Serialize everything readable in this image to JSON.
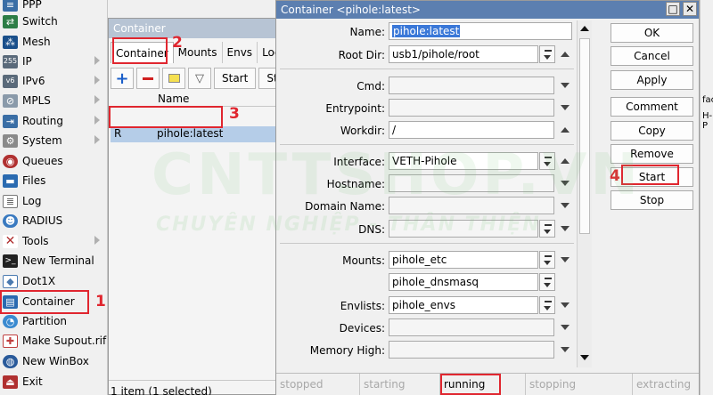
{
  "sidebar": {
    "items": [
      {
        "label": "PPP",
        "icon": "ppp-icon",
        "color": "#3a6ea5",
        "arrow": false
      },
      {
        "label": "Switch",
        "icon": "switch-icon",
        "color": "#2d7d46",
        "arrow": false
      },
      {
        "label": "Mesh",
        "icon": "mesh-icon",
        "color": "#1a4f8a",
        "arrow": false
      },
      {
        "label": "IP",
        "icon": "ip-icon",
        "color": "#5a6a7a",
        "arrow": true
      },
      {
        "label": "IPv6",
        "icon": "ipv6-icon",
        "color": "#5a6a7a",
        "arrow": true
      },
      {
        "label": "MPLS",
        "icon": "mpls-icon",
        "color": "#7a8a9a",
        "arrow": true
      },
      {
        "label": "Routing",
        "icon": "routing-icon",
        "color": "#3a6ea5",
        "arrow": true
      },
      {
        "label": "System",
        "icon": "gear-icon",
        "color": "#7a7a7a",
        "arrow": true
      },
      {
        "label": "Queues",
        "icon": "queues-icon",
        "color": "#b03030",
        "arrow": false
      },
      {
        "label": "Files",
        "icon": "folder-icon",
        "color": "#2a6ab0",
        "arrow": false
      },
      {
        "label": "Log",
        "icon": "log-icon",
        "color": "#6a6a6a",
        "arrow": false
      },
      {
        "label": "RADIUS",
        "icon": "radius-icon",
        "color": "#3a7ac0",
        "arrow": false
      },
      {
        "label": "Tools",
        "icon": "tools-icon",
        "color": "#b03030",
        "arrow": true
      },
      {
        "label": "New Terminal",
        "icon": "terminal-icon",
        "color": "#222222",
        "arrow": false
      },
      {
        "label": "Dot1X",
        "icon": "dot1x-icon",
        "color": "#4a7ab0",
        "arrow": false
      },
      {
        "label": "Container",
        "icon": "container-icon",
        "color": "#2a6ab0",
        "arrow": false
      },
      {
        "label": "Partition",
        "icon": "partition-icon",
        "color": "#3a8ad0",
        "arrow": false
      },
      {
        "label": "Make Supout.rif",
        "icon": "supout-icon",
        "color": "#c04040",
        "arrow": false
      },
      {
        "label": "New WinBox",
        "icon": "winbox-icon",
        "color": "#2a5a9a",
        "arrow": false
      },
      {
        "label": "Exit",
        "icon": "exit-icon",
        "color": "#b03030",
        "arrow": false
      }
    ]
  },
  "list_window": {
    "title": "Container",
    "tabs": [
      "Container",
      "Mounts",
      "Envs",
      "Log"
    ],
    "toolbar": {
      "start": "Start",
      "stop_truncated": "Sto"
    },
    "header": {
      "name": "Name"
    },
    "row": {
      "flag": "R",
      "name": "pihole:latest"
    },
    "status": "1 item (1 selected)"
  },
  "dialog": {
    "title": "Container <pihole:latest>",
    "fields": {
      "name": {
        "label": "Name:",
        "value": "pihole:latest"
      },
      "root_dir": {
        "label": "Root Dir:",
        "value": "usb1/pihole/root"
      },
      "cmd": {
        "label": "Cmd:",
        "value": ""
      },
      "entrypoint": {
        "label": "Entrypoint:",
        "value": ""
      },
      "workdir": {
        "label": "Workdir:",
        "value": "/"
      },
      "interface": {
        "label": "Interface:",
        "value": "VETH-Pihole"
      },
      "hostname": {
        "label": "Hostname:",
        "value": ""
      },
      "domain_name": {
        "label": "Domain Name:",
        "value": ""
      },
      "dns": {
        "label": "DNS:",
        "value": ""
      },
      "mounts": {
        "label": "Mounts:",
        "value1": "pihole_etc",
        "value2": "pihole_dnsmasq"
      },
      "envlists": {
        "label": "Envlists:",
        "value": "pihole_envs"
      },
      "devices": {
        "label": "Devices:",
        "value": ""
      },
      "memory_high": {
        "label": "Memory High:",
        "value": ""
      }
    },
    "buttons": {
      "ok": "OK",
      "cancel": "Cancel",
      "apply": "Apply",
      "comment": "Comment",
      "copy": "Copy",
      "remove": "Remove",
      "start": "Start",
      "stop": "Stop"
    },
    "status_bar": [
      "stopped",
      "starting",
      "running",
      "stopping",
      "extracting"
    ],
    "status_active": "running"
  },
  "right_window": {
    "line1": "fac",
    "line2": "H-P"
  },
  "annotations": {
    "n1": "1",
    "n2": "2",
    "n3": "3",
    "n4": "4",
    "color": "#e0262f"
  },
  "watermark": {
    "line1": "CNTTSHOP.VN",
    "line2": "CHUYÊN NGHIỆP - THÂN THIỆN"
  }
}
